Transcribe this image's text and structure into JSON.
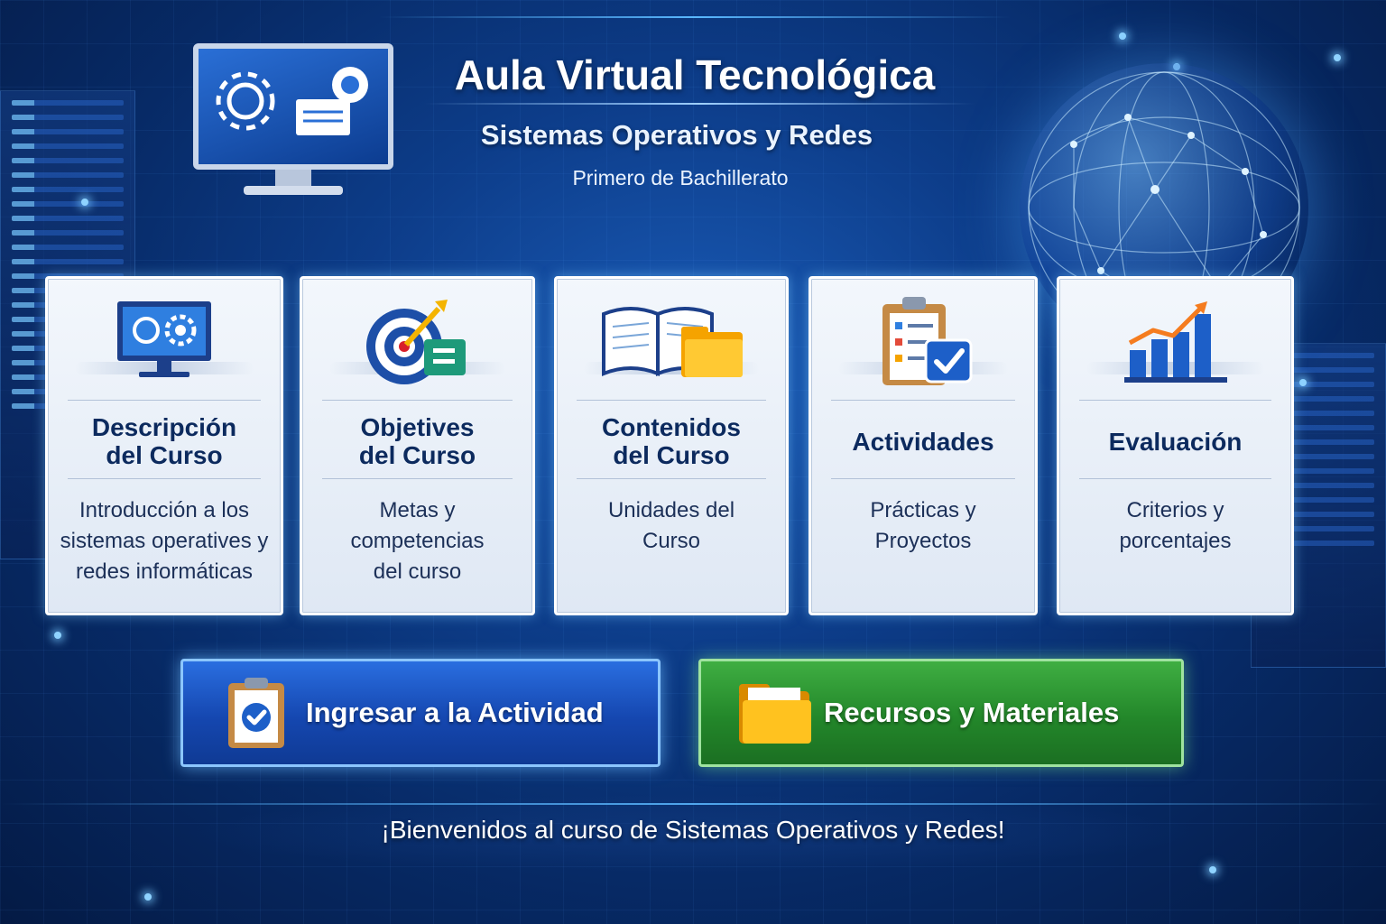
{
  "header": {
    "title": "Aula Virtual Tecnológica",
    "subtitle": "Sistemas Operativos y Redes",
    "level": "Primero de Bachillerato"
  },
  "cards": [
    {
      "title": "Descripción\ndel Curso",
      "description": "Introducción a los\nsistemas operatives y\nredes informáticas",
      "icon": "computer-settings-icon"
    },
    {
      "title": "Objetives\ndel Curso",
      "description": "Metas y\ncompetencias\ndel curso",
      "icon": "target-icon"
    },
    {
      "title": "Contenidos\ndel Curso",
      "description": "Unidades del\nCurso",
      "icon": "book-folder-icon"
    },
    {
      "title": "Actividades",
      "description": "Prácticas y\nProyectos",
      "icon": "clipboard-check-icon"
    },
    {
      "title": "Evaluación",
      "description": "Criterios y\nporcentajes",
      "icon": "bar-chart-icon"
    }
  ],
  "buttons": {
    "activity": {
      "label": "Ingresar a la Actividad",
      "icon": "clipboard-check-icon"
    },
    "resources": {
      "label": "Recursos y Materiales",
      "icon": "folder-icon"
    }
  },
  "footer": {
    "welcome": "¡Bienvenidos al curso de Sistemas Operativos y Redes!"
  },
  "colors": {
    "background": "#0d3d8a",
    "card_title": "#0c2a5e",
    "button_blue": "#1547b0",
    "button_green": "#23872a"
  }
}
